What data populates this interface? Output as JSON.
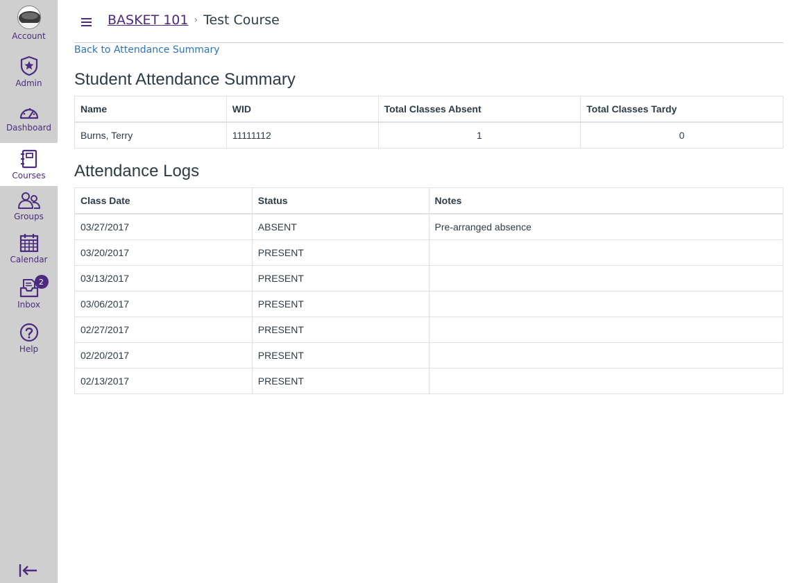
{
  "nav": {
    "items": [
      {
        "label": "Account",
        "icon": "account-avatar"
      },
      {
        "label": "Admin",
        "icon": "admin-shield-icon"
      },
      {
        "label": "Dashboard",
        "icon": "dashboard-gauge-icon"
      },
      {
        "label": "Courses",
        "icon": "courses-book-icon",
        "active": true
      },
      {
        "label": "Groups",
        "icon": "groups-people-icon"
      },
      {
        "label": "Calendar",
        "icon": "calendar-icon"
      },
      {
        "label": "Inbox",
        "icon": "inbox-icon",
        "badge": "2"
      },
      {
        "label": "Help",
        "icon": "help-question-icon"
      }
    ],
    "collapse_icon": "collapse-nav-icon"
  },
  "header": {
    "crumb_course": "BASKET 101",
    "crumb_separator": "›",
    "crumb_current": "Test Course"
  },
  "back_link": "Back to Attendance Summary",
  "summary": {
    "title": "Student Attendance Summary",
    "columns": [
      "Name",
      "WID",
      "Total Classes Absent",
      "Total Classes Tardy"
    ],
    "row": {
      "name": "Burns, Terry",
      "wid": "11111112",
      "absent": "1",
      "tardy": "0"
    }
  },
  "logs": {
    "title": "Attendance Logs",
    "columns": [
      "Class Date",
      "Status",
      "Notes"
    ],
    "rows": [
      {
        "date": "03/27/2017",
        "status": "ABSENT",
        "notes": "Pre-arranged absence"
      },
      {
        "date": "03/20/2017",
        "status": "PRESENT",
        "notes": ""
      },
      {
        "date": "03/13/2017",
        "status": "PRESENT",
        "notes": ""
      },
      {
        "date": "03/06/2017",
        "status": "PRESENT",
        "notes": ""
      },
      {
        "date": "02/27/2017",
        "status": "PRESENT",
        "notes": ""
      },
      {
        "date": "02/20/2017",
        "status": "PRESENT",
        "notes": ""
      },
      {
        "date": "02/13/2017",
        "status": "PRESENT",
        "notes": ""
      }
    ]
  },
  "colors": {
    "brand": "#4b2a7f",
    "link": "#2d73b6",
    "nav_bg": "#cfcfcf"
  }
}
